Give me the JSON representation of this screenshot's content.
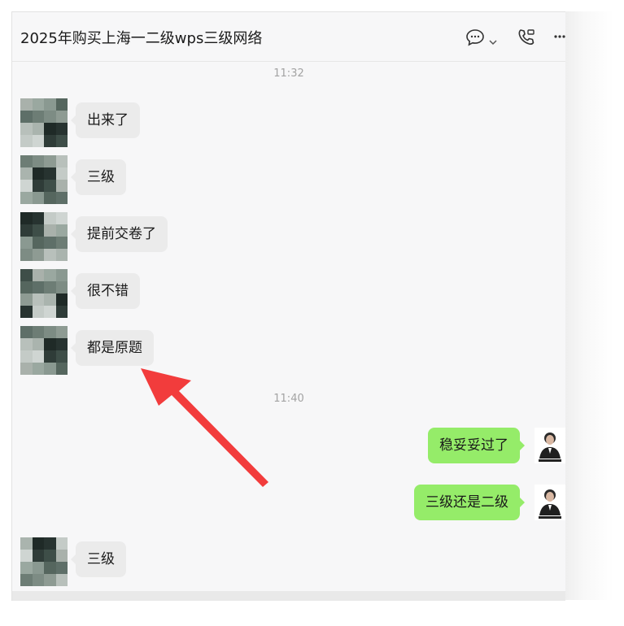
{
  "header": {
    "title": "2025年购买上海一二级wps三级网络",
    "icons": [
      "chat-bubble-icon",
      "chevron-down-icon",
      "phone-icon",
      "more-icon"
    ]
  },
  "timestamps": [
    "11:32",
    "11:40"
  ],
  "messages": [
    {
      "side": "in",
      "text": "出来了"
    },
    {
      "side": "in",
      "text": "三级"
    },
    {
      "side": "in",
      "text": "提前交卷了"
    },
    {
      "side": "in",
      "text": "很不错"
    },
    {
      "side": "in",
      "text": "都是原题"
    },
    {
      "side": "out",
      "text": "稳妥妥过了"
    },
    {
      "side": "out",
      "text": "三级还是二级"
    },
    {
      "side": "in",
      "text": "三级"
    }
  ],
  "annotation": {
    "type": "red-arrow",
    "color": "#f23c3c",
    "points_to": "都是原题"
  },
  "colors": {
    "incoming_bubble": "#ebebeb",
    "outgoing_bubble": "#95ec69",
    "background": "#f7f7f8"
  }
}
